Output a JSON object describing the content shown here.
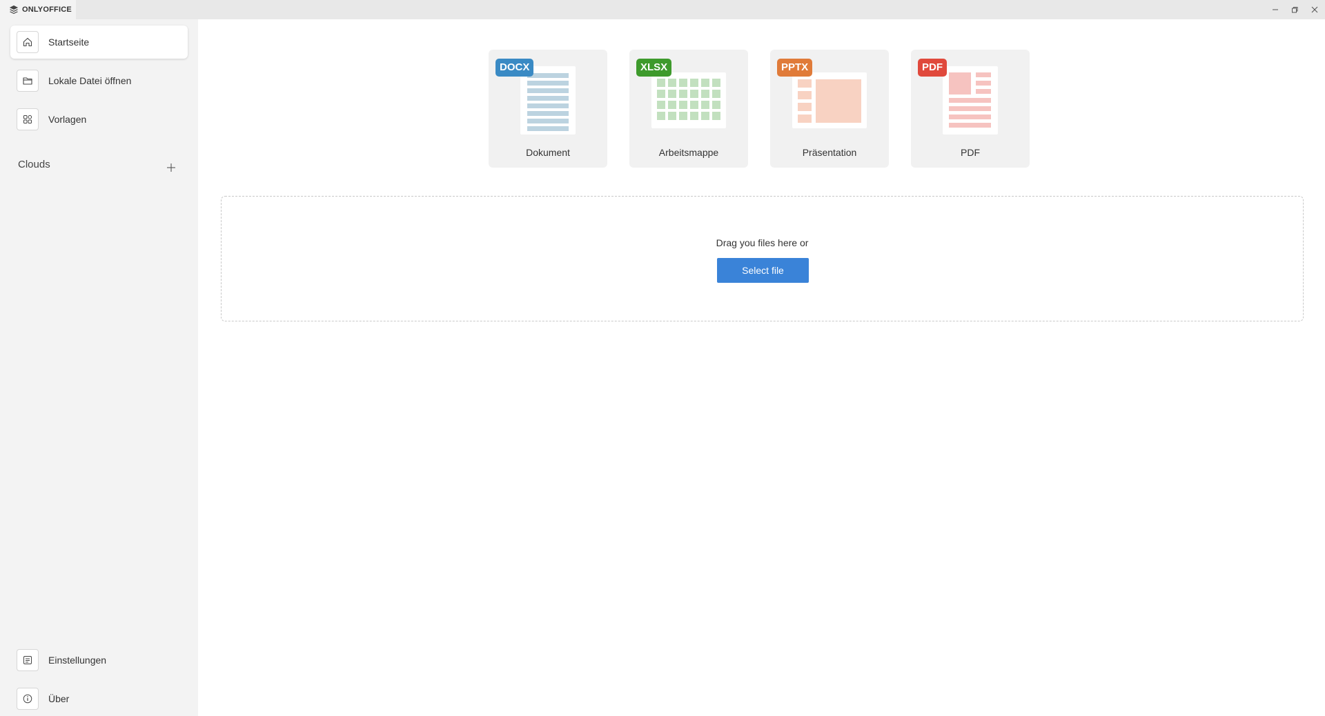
{
  "app": {
    "brand": "ONLYOFFICE"
  },
  "sidebar": {
    "items": [
      {
        "label": "Startseite",
        "icon": "home-icon",
        "active": true
      },
      {
        "label": "Lokale Datei öffnen",
        "icon": "folder-icon",
        "active": false
      },
      {
        "label": "Vorlagen",
        "icon": "templates-grid-icon",
        "active": false
      }
    ],
    "clouds_label": "Clouds",
    "bottom": [
      {
        "label": "Einstellungen",
        "icon": "settings-icon"
      },
      {
        "label": "Über",
        "icon": "info-icon"
      }
    ]
  },
  "templates": [
    {
      "badge": "DOCX",
      "label": "Dokument",
      "color": "#3a8ac4"
    },
    {
      "badge": "XLSX",
      "label": "Arbeitsmappe",
      "color": "#3e9a2c"
    },
    {
      "badge": "PPTX",
      "label": "Präsentation",
      "color": "#e07b39"
    },
    {
      "badge": "PDF",
      "label": "PDF",
      "color": "#e0493c"
    }
  ],
  "dropzone": {
    "text": "Drag you files here or",
    "button": "Select file"
  },
  "colors": {
    "accent": "#3a83d8",
    "sidebar_bg": "#f3f3f3",
    "titlebar_bg": "#e8e8e8"
  }
}
